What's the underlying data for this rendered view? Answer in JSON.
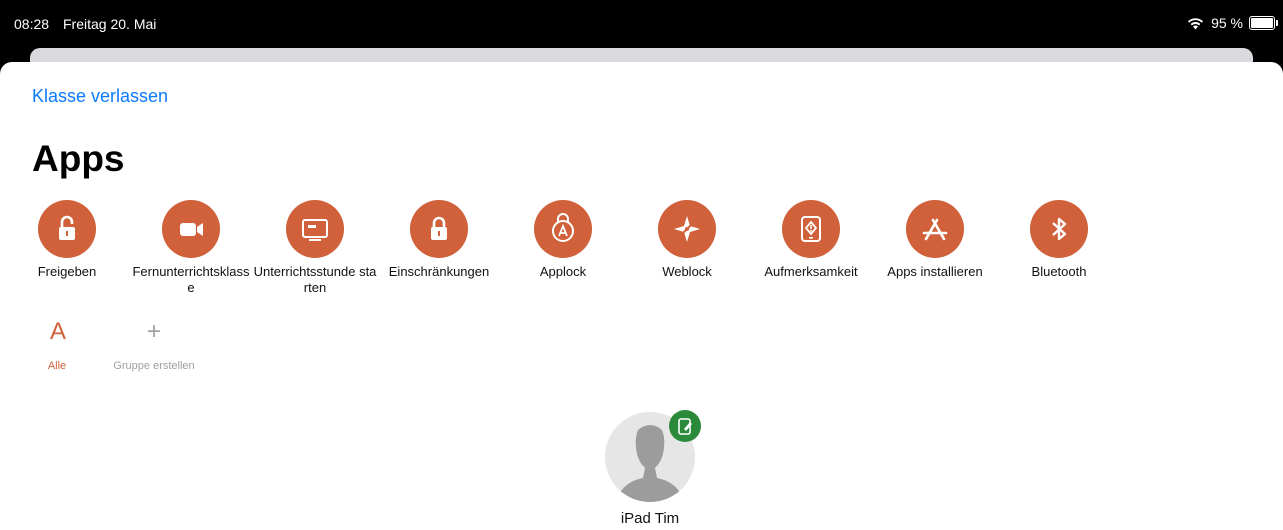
{
  "status_bar": {
    "time": "08:28",
    "date": "Freitag 20. Mai",
    "battery": "95 %"
  },
  "header": {
    "back_label": "Klasse verlassen",
    "title": "Apps"
  },
  "accent_color": "#d0613a",
  "link_color": "#0a7aff",
  "apps": [
    {
      "label": "Freigeben",
      "icon": "unlock-icon"
    },
    {
      "label": "Fernunterrichtsklasse",
      "icon": "video-camera-icon"
    },
    {
      "label": "Unterrichtsstunde starten",
      "icon": "blackboard-icon"
    },
    {
      "label": "Einschränkungen",
      "icon": "lock-icon"
    },
    {
      "label": "Applock",
      "icon": "app-lock-icon"
    },
    {
      "label": "Weblock",
      "icon": "compass-icon"
    },
    {
      "label": "Aufmerksamkeit",
      "icon": "tablet-alert-icon"
    },
    {
      "label": "Apps installieren",
      "icon": "app-store-icon"
    },
    {
      "label": "Bluetooth",
      "icon": "bluetooth-icon"
    }
  ],
  "groups": [
    {
      "glyph": "A",
      "label": "Alle",
      "color": "#d0613a"
    },
    {
      "glyph": "+",
      "label": "Gruppe erstellen",
      "color": "#a0a0a0"
    }
  ],
  "device": {
    "name": "iPad Tim",
    "badge_color": "#2a8a3a"
  }
}
